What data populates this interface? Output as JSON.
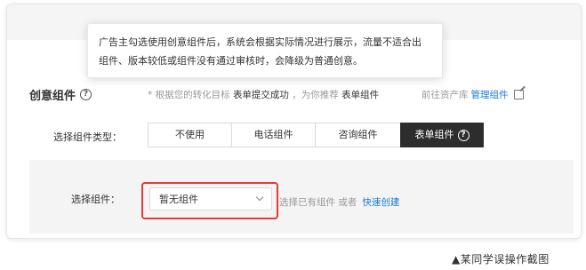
{
  "tooltip": {
    "line1": "广告主勾选使用创意组件后，系统会根据实际情况进行展示，流量不适合出",
    "line2": "组件、版本较低或组件没有通过审核时，会降级为普通创意。"
  },
  "section": {
    "title": "创意组件",
    "help_glyph": "?",
    "hint_prefix": "* 根据您的转化目标",
    "hint_goal": "表单提交成功",
    "hint_middle": "，为你推荐",
    "hint_recommend": "表单组件",
    "manage_prefix": "前往资产库",
    "manage_link": "管理组件"
  },
  "type_selector": {
    "label": "选择组件类型：",
    "options": [
      "不使用",
      "电话组件",
      "咨询组件",
      "表单组件"
    ],
    "selected": "表单组件"
  },
  "picker": {
    "label": "选择组件：",
    "value": "暂无组件",
    "existing_text": "选择已有组件 或者",
    "create_link": "快速创建"
  },
  "caption": "▲某同学误操作截图",
  "colors": {
    "accent_link": "#1a7bd6",
    "highlight_border": "#e53935",
    "active_tab": "#2d2d2d"
  },
  "icons": {
    "help": "question-circle-icon",
    "edit": "edit-icon",
    "dropdown": "chevron-down-icon"
  }
}
